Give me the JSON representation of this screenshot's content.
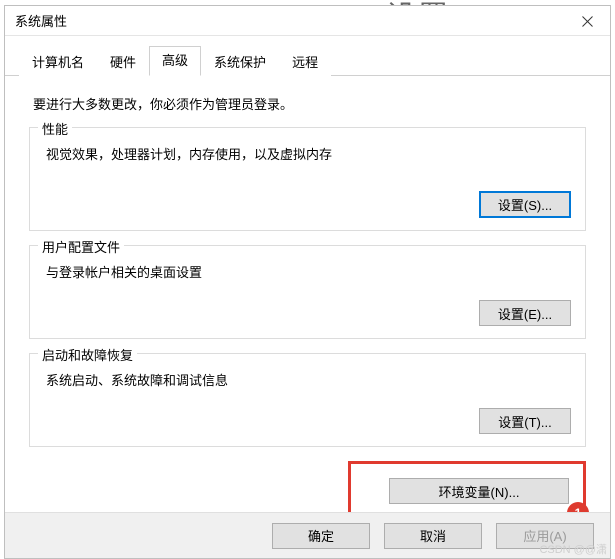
{
  "background_title": "Windows 设置",
  "dialog": {
    "title": "系统属性"
  },
  "tabs": {
    "items": [
      {
        "label": "计算机名"
      },
      {
        "label": "硬件"
      },
      {
        "label": "高级"
      },
      {
        "label": "系统保护"
      },
      {
        "label": "远程"
      }
    ],
    "active_index": 2
  },
  "intro": "要进行大多数更改，你必须作为管理员登录。",
  "groups": {
    "performance": {
      "title": "性能",
      "desc": "视觉效果，处理器计划，内存使用，以及虚拟内存",
      "button": "设置(S)..."
    },
    "user_profile": {
      "title": "用户配置文件",
      "desc": "与登录帐户相关的桌面设置",
      "button": "设置(E)..."
    },
    "startup": {
      "title": "启动和故障恢复",
      "desc": "系统启动、系统故障和调试信息",
      "button": "设置(T)..."
    }
  },
  "env_button": "环境变量(N)...",
  "badge": "1",
  "footer": {
    "ok": "确定",
    "cancel": "取消",
    "apply": "应用(A)"
  },
  "watermark": "CSDN @@潇"
}
